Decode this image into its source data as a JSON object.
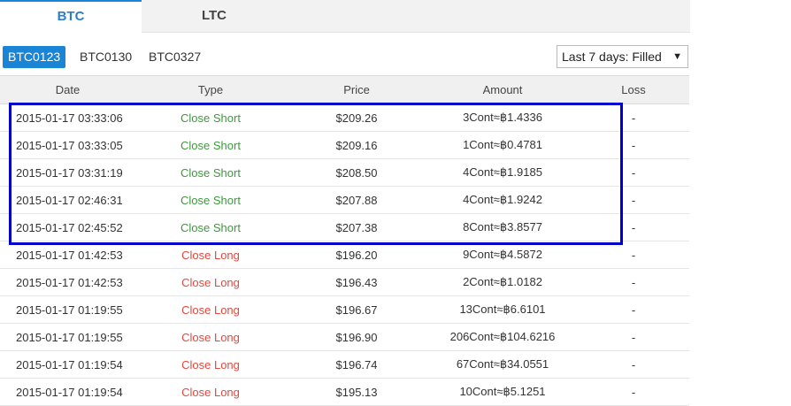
{
  "tabs": [
    {
      "label": "BTC",
      "active": true
    },
    {
      "label": "LTC",
      "active": false
    }
  ],
  "contracts": [
    {
      "label": "BTC0123",
      "active": true
    },
    {
      "label": "BTC0130",
      "active": false
    },
    {
      "label": "BTC0327",
      "active": false
    }
  ],
  "filter": {
    "selected": "Last 7 days: Filled"
  },
  "table": {
    "headers": {
      "date": "Date",
      "type": "Type",
      "price": "Price",
      "amount": "Amount",
      "loss": "Loss"
    },
    "rows": [
      {
        "date": "2015-01-17 03:33:06",
        "type": "Close Short",
        "price": "$209.26",
        "amount": "3Cont≈฿1.4336",
        "loss": "-"
      },
      {
        "date": "2015-01-17 03:33:05",
        "type": "Close Short",
        "price": "$209.16",
        "amount": "1Cont≈฿0.4781",
        "loss": "-"
      },
      {
        "date": "2015-01-17 03:31:19",
        "type": "Close Short",
        "price": "$208.50",
        "amount": "4Cont≈฿1.9185",
        "loss": "-"
      },
      {
        "date": "2015-01-17 02:46:31",
        "type": "Close Short",
        "price": "$207.88",
        "amount": "4Cont≈฿1.9242",
        "loss": "-"
      },
      {
        "date": "2015-01-17 02:45:52",
        "type": "Close Short",
        "price": "$207.38",
        "amount": "8Cont≈฿3.8577",
        "loss": "-"
      },
      {
        "date": "2015-01-17 01:42:53",
        "type": "Close Long",
        "price": "$196.20",
        "amount": "9Cont≈฿4.5872",
        "loss": "-"
      },
      {
        "date": "2015-01-17 01:42:53",
        "type": "Close Long",
        "price": "$196.43",
        "amount": "2Cont≈฿1.0182",
        "loss": "-"
      },
      {
        "date": "2015-01-17 01:19:55",
        "type": "Close Long",
        "price": "$196.67",
        "amount": "13Cont≈฿6.6101",
        "loss": "-"
      },
      {
        "date": "2015-01-17 01:19:55",
        "type": "Close Long",
        "price": "$196.90",
        "amount": "206Cont≈฿104.6216",
        "loss": "-"
      },
      {
        "date": "2015-01-17 01:19:54",
        "type": "Close Long",
        "price": "$196.74",
        "amount": "67Cont≈฿34.0551",
        "loss": "-"
      },
      {
        "date": "2015-01-17 01:19:54",
        "type": "Close Long",
        "price": "$195.13",
        "amount": "10Cont≈฿5.1251",
        "loss": "-"
      }
    ]
  },
  "colors": {
    "accent": "#1a85d5",
    "close_short": "#3c9a3c",
    "close_long": "#e0493e",
    "highlight_border": "#0000cc"
  }
}
